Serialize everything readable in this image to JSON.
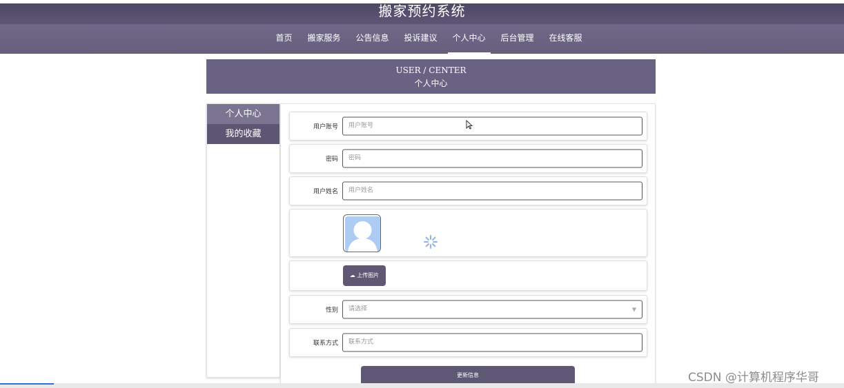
{
  "header": {
    "site_title": "搬家预约系统"
  },
  "nav": {
    "items": [
      {
        "label": "首页"
      },
      {
        "label": "搬家服务"
      },
      {
        "label": "公告信息"
      },
      {
        "label": "投诉建议"
      },
      {
        "label": "个人中心",
        "active": true
      },
      {
        "label": "后台管理"
      },
      {
        "label": "在线客服"
      }
    ]
  },
  "banner": {
    "en": "USER / CENTER",
    "zh": "个人中心"
  },
  "sidebar": {
    "items": [
      {
        "label": "个人中心",
        "active": true
      },
      {
        "label": "我的收藏",
        "active": false
      }
    ]
  },
  "form": {
    "account": {
      "label": "用户账号",
      "placeholder": "用户账号"
    },
    "password": {
      "label": "密码",
      "placeholder": "密码"
    },
    "name": {
      "label": "用户姓名",
      "placeholder": "用户姓名"
    },
    "upload_label": "上传图片",
    "gender": {
      "label": "性别",
      "placeholder": "请选择"
    },
    "phone": {
      "label": "联系方式",
      "placeholder": "联系方式"
    },
    "submit_label": "更新信息"
  },
  "watermark": "CSDN @计算机程序华哥",
  "colors": {
    "header_bg": "#4e4764",
    "nav_bg": "#6f6887",
    "accent": "#5f5875",
    "progress": "#2f6fd6"
  },
  "icons": [
    "avatar-placeholder-icon",
    "loading-spinner-icon",
    "upload-cloud-icon",
    "chevron-down-icon",
    "mouse-cursor-icon"
  ]
}
